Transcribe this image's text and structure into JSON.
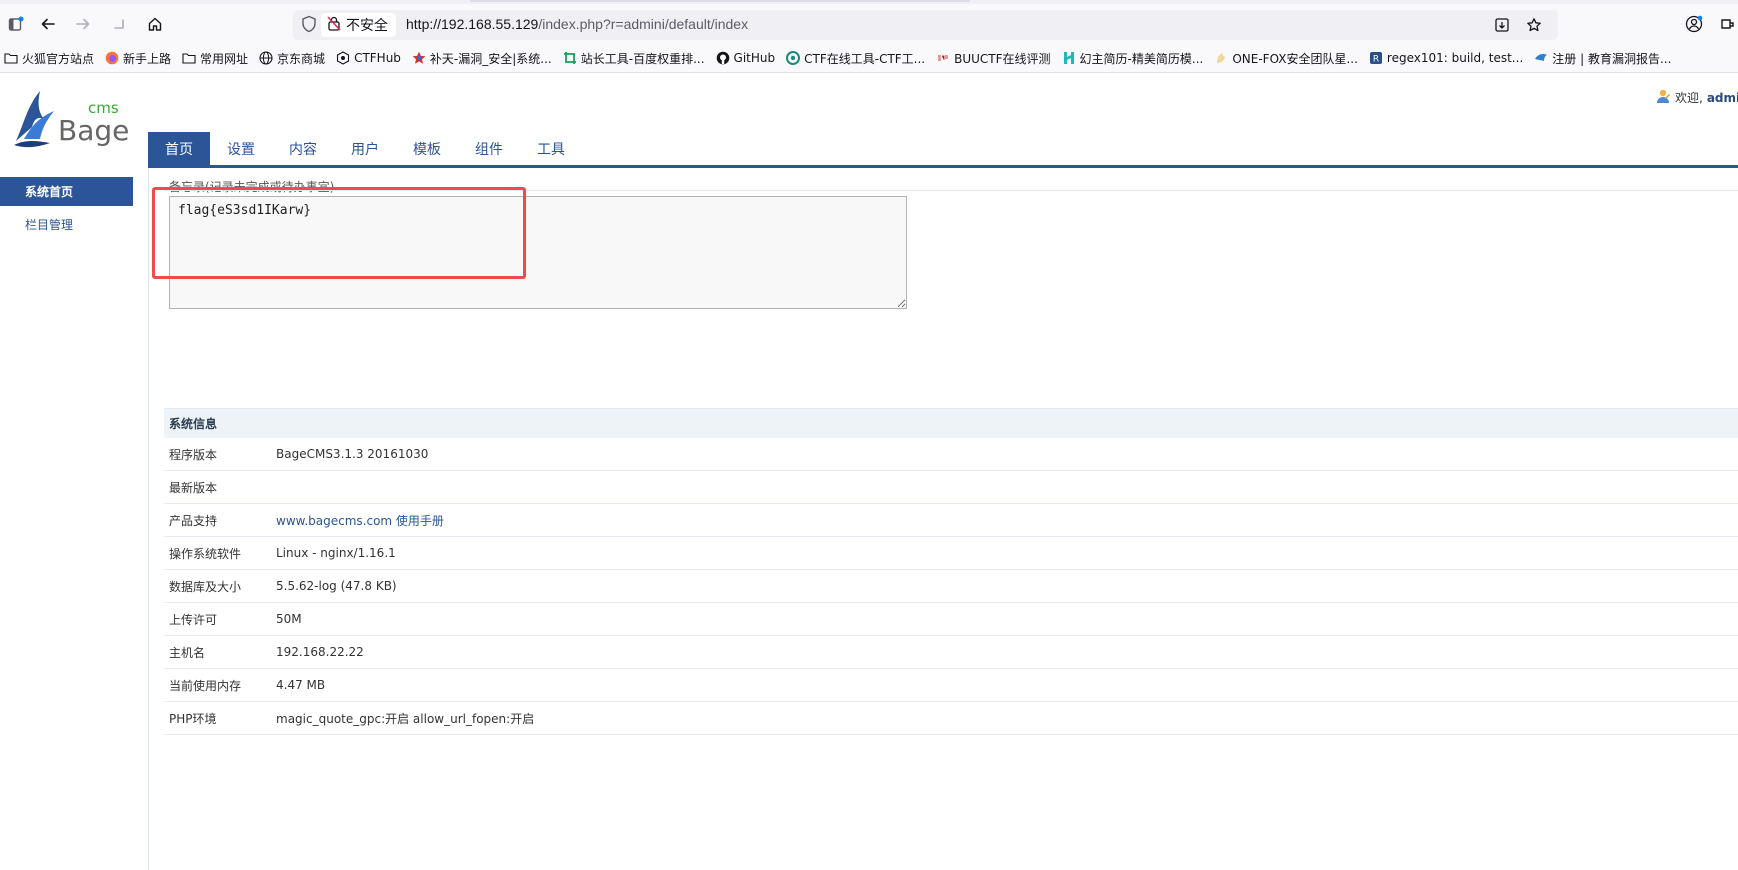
{
  "browser": {
    "insecure_label": "不安全",
    "url_host": "http://192.168.55.129",
    "url_path": "/index.php?r=admini/default/index"
  },
  "bookmarks": [
    {
      "label": "火狐官方站点",
      "icon": "folder-icon"
    },
    {
      "label": "新手上路",
      "icon": "firefox-icon"
    },
    {
      "label": "常用网址",
      "icon": "folder-icon"
    },
    {
      "label": "京东商城",
      "icon": "globe-icon"
    },
    {
      "label": "CTFHub",
      "icon": "ctfhub-icon"
    },
    {
      "label": "补天-漏洞_安全|系统...",
      "icon": "butian-star-icon"
    },
    {
      "label": "站长工具-百度权重排...",
      "icon": "chinaz-icon"
    },
    {
      "label": "GitHub",
      "icon": "github-icon"
    },
    {
      "label": "CTF在线工具-CTF工...",
      "icon": "ctftools-icon"
    },
    {
      "label": "BUUCTF在线评测",
      "icon": "buuctf-icon"
    },
    {
      "label": "幻主简历-精美简历模...",
      "icon": "huanzhu-icon"
    },
    {
      "label": "ONE-FOX安全团队星...",
      "icon": "onefox-icon"
    },
    {
      "label": "regex101: build, test...",
      "icon": "regex101-icon"
    },
    {
      "label": "注册 | 教育漏洞报告...",
      "icon": "edusrc-icon"
    }
  ],
  "header": {
    "welcome_prefix": "欢迎,",
    "welcome_user": "admi"
  },
  "nav": [
    {
      "label": "首页",
      "active": true
    },
    {
      "label": "设置",
      "active": false
    },
    {
      "label": "内容",
      "active": false
    },
    {
      "label": "用户",
      "active": false
    },
    {
      "label": "模板",
      "active": false
    },
    {
      "label": "组件",
      "active": false
    },
    {
      "label": "工具",
      "active": false
    }
  ],
  "sidebar": [
    {
      "label": "系统首页",
      "active": true
    },
    {
      "label": "栏目管理",
      "active": false
    }
  ],
  "memo": {
    "label": "备忘录(记录未完成或待办事宜)",
    "value": "flag{eS3sd1IKarw}"
  },
  "sysinfo": {
    "title": "系统信息",
    "rows": [
      {
        "key": "程序版本",
        "value": "BageCMS3.1.3 20161030"
      },
      {
        "key": "最新版本",
        "value": ""
      },
      {
        "key": "产品支持",
        "value": "www.bagecms.com 使用手册",
        "link": true
      },
      {
        "key": "操作系统软件",
        "value": "Linux - nginx/1.16.1"
      },
      {
        "key": "数据库及大小",
        "value": "5.5.62-log (47.8 KB)"
      },
      {
        "key": "上传许可",
        "value": "50M"
      },
      {
        "key": "主机名",
        "value": "192.168.22.22"
      },
      {
        "key": "当前使用内存",
        "value": "4.47 MB"
      },
      {
        "key": "PHP环境",
        "value": "magic_quote_gpc:开启 allow_url_fopen:开启"
      }
    ]
  },
  "colors": {
    "accent": "#2b5597",
    "highlight_box": "#ee4b4b"
  }
}
